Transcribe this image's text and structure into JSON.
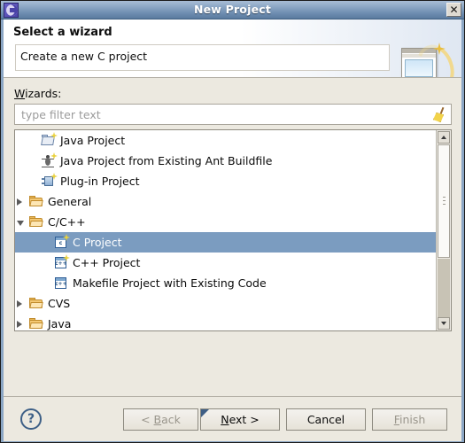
{
  "window": {
    "title": "New Project",
    "app_icon": "eclipse-icon",
    "close_label": "✕"
  },
  "header": {
    "title": "Select a wizard",
    "description": "Create a new C project",
    "banner_icon": "wizard-window-sparkle-icon"
  },
  "filter": {
    "label": "Wizards:",
    "label_mnemonic": "W",
    "label_rest": "izards:",
    "placeholder": "type filter text",
    "value": "",
    "clear_icon": "broom-icon"
  },
  "tree": {
    "items": [
      {
        "label": "Java Project",
        "icon": "java-project-icon",
        "indent": 30,
        "twisty": "none",
        "selected": false
      },
      {
        "label": "Java Project from Existing Ant Buildfile",
        "icon": "ant-buildfile-icon",
        "indent": 30,
        "twisty": "none",
        "selected": false
      },
      {
        "label": "Plug-in Project",
        "icon": "plugin-project-icon",
        "indent": 30,
        "twisty": "none",
        "selected": false
      },
      {
        "label": "General",
        "icon": "folder-icon",
        "indent": 16,
        "twisty": "collapsed",
        "selected": false
      },
      {
        "label": "C/C++",
        "icon": "folder-icon",
        "indent": 16,
        "twisty": "expanded",
        "selected": false
      },
      {
        "label": "C Project",
        "icon": "c-project-icon",
        "indent": 44,
        "twisty": "none",
        "selected": true
      },
      {
        "label": "C++ Project",
        "icon": "cpp-project-icon",
        "indent": 44,
        "twisty": "none",
        "selected": false
      },
      {
        "label": "Makefile Project with Existing Code",
        "icon": "makefile-project-icon",
        "indent": 44,
        "twisty": "none",
        "selected": false
      },
      {
        "label": "CVS",
        "icon": "folder-icon",
        "indent": 16,
        "twisty": "collapsed",
        "selected": false
      },
      {
        "label": "Java",
        "icon": "folder-icon",
        "indent": 16,
        "twisty": "collapsed",
        "selected": false
      }
    ],
    "icon_text": {
      "c": "c",
      "cpp": "c++",
      "makefile": "c++"
    },
    "selection_color": "#7b9cc0"
  },
  "scrollbar": {
    "up_icon": "scroll-up-arrow-icon",
    "down_icon": "scroll-down-arrow-icon"
  },
  "buttons": {
    "help_label": "?",
    "back": {
      "prefix": "< ",
      "mnemonic": "B",
      "suffix": "ack"
    },
    "next": {
      "prefix": "",
      "mnemonic": "N",
      "suffix": "ext >"
    },
    "cancel": {
      "label": "Cancel"
    },
    "finish": {
      "prefix": "",
      "mnemonic": "F",
      "suffix": "inish"
    }
  }
}
